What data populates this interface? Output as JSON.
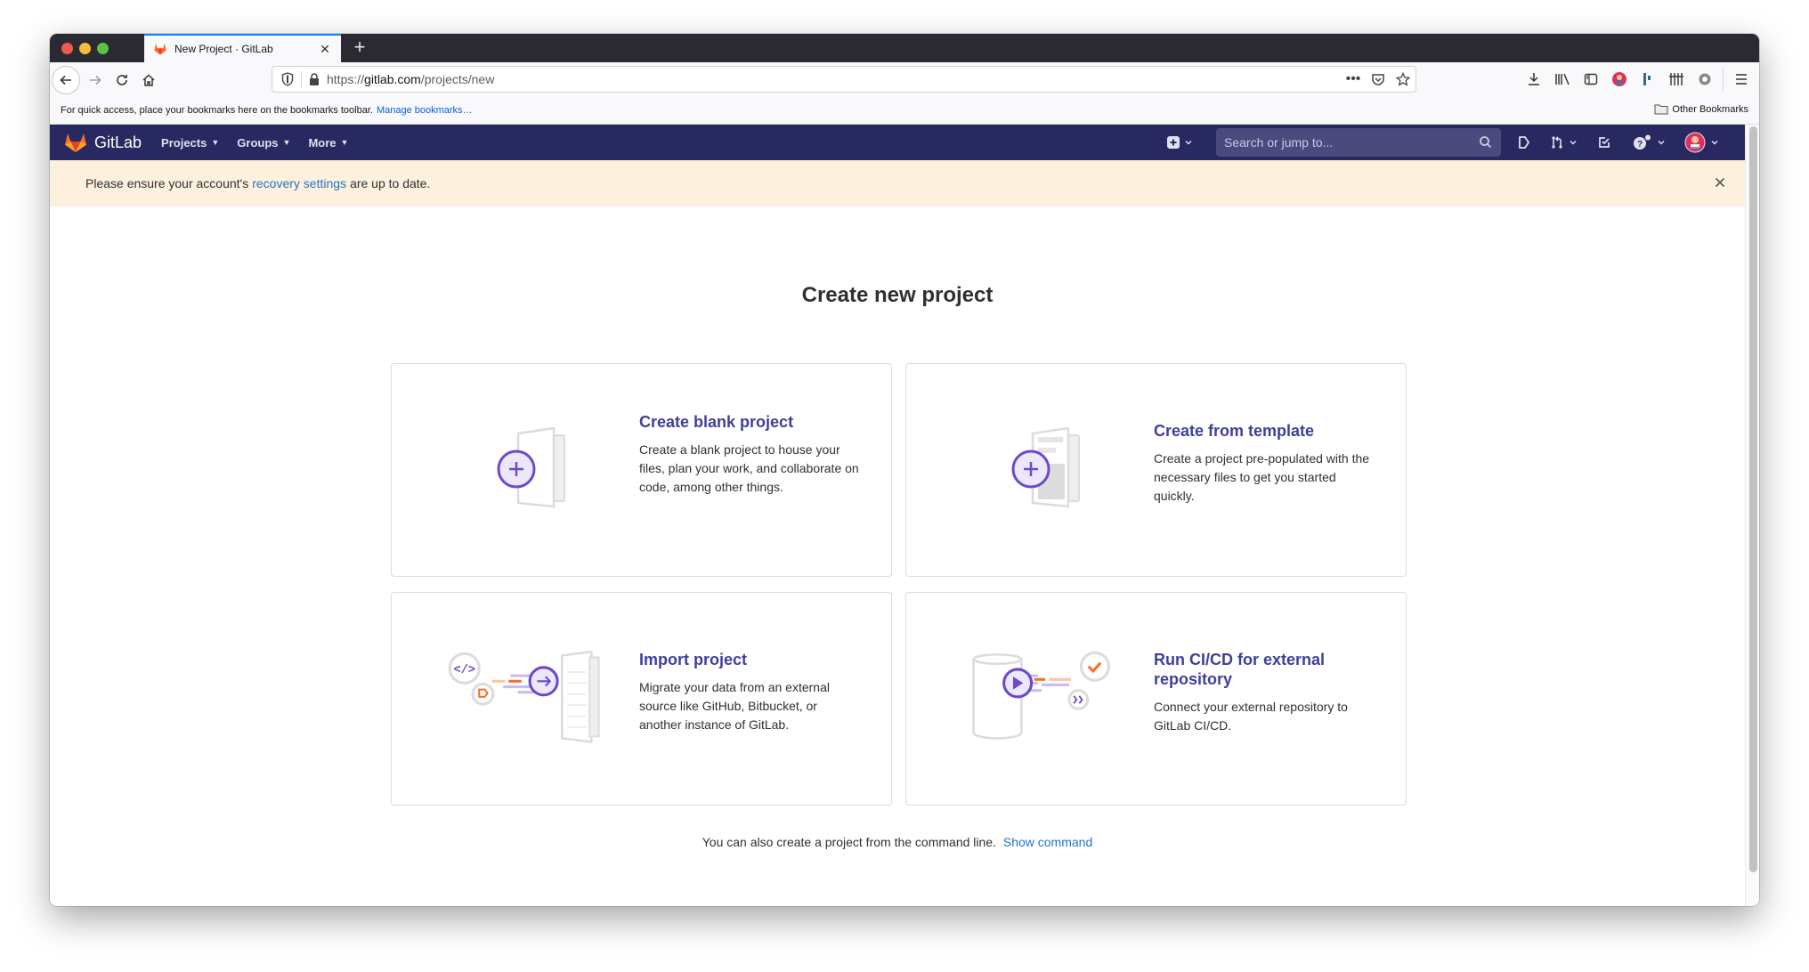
{
  "browser": {
    "tab_title": "New Project · GitLab",
    "url_prefix": "https://",
    "url_domain": "gitlab.com",
    "url_path": "/projects/new",
    "bookmarks_hint": "For quick access, place your bookmarks here on the bookmarks toolbar.",
    "manage_bookmarks": "Manage bookmarks…",
    "other_bookmarks": "Other Bookmarks"
  },
  "gitlab_header": {
    "brand": "GitLab",
    "nav": [
      {
        "label": "Projects"
      },
      {
        "label": "Groups"
      },
      {
        "label": "More"
      }
    ],
    "search_placeholder": "Search or jump to..."
  },
  "alert": {
    "prefix": "Please ensure your account's",
    "link": "recovery settings",
    "suffix": "are up to date."
  },
  "main": {
    "title": "Create new project",
    "cards": [
      {
        "title": "Create blank project",
        "description": "Create a blank project to house your files, plan your work, and collaborate on code, among other things."
      },
      {
        "title": "Create from template",
        "description": "Create a project pre-populated with the necessary files to get you started quickly."
      },
      {
        "title": "Import project",
        "description": "Migrate your data from an external source like GitHub, Bitbucket, or another instance of GitLab."
      },
      {
        "title": "Run CI/CD for external repository",
        "description": "Connect your external repository to GitLab CI/CD."
      }
    ],
    "footer_text": "You can also create a project from the command line.",
    "footer_link": "Show command"
  },
  "colors": {
    "header_bg": "#292961",
    "alert_bg": "#fdf1dd",
    "link": "#1f75cb",
    "card_title": "#3f3f9b",
    "illustration_purple": "#6e49cb",
    "illustration_orange": "#fc6d26"
  }
}
